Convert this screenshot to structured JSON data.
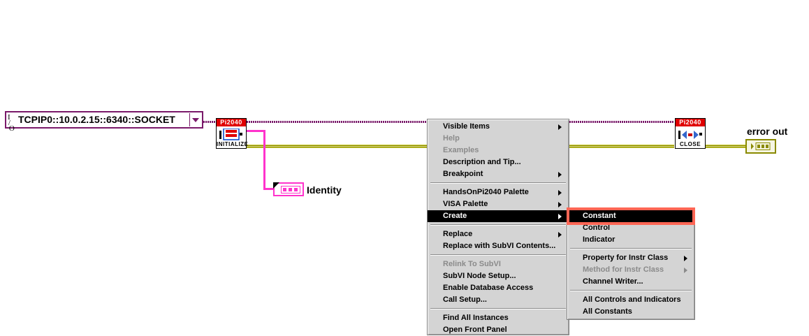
{
  "visa_control": {
    "io_label": "I/O",
    "value": "TCPIP0::10.0.2.15::6340::SOCKET"
  },
  "initialize_vi": {
    "header": "Pi2040",
    "footer": "INITIALIZE"
  },
  "close_vi": {
    "header": "Pi2040",
    "footer": "CLOSE"
  },
  "identity_indicator": {
    "label": "Identity"
  },
  "error_out_indicator": {
    "label": "error out"
  },
  "context_menu": {
    "items": [
      {
        "label": "Visible Items",
        "submenu": true,
        "disabled": false
      },
      {
        "label": "Help",
        "submenu": false,
        "disabled": true
      },
      {
        "label": "Examples",
        "submenu": false,
        "disabled": true
      },
      {
        "label": "Description and Tip...",
        "submenu": false,
        "disabled": false
      },
      {
        "label": "Breakpoint",
        "submenu": true,
        "disabled": false
      },
      {
        "label": "HandsOnPi2040 Palette",
        "submenu": true,
        "disabled": false
      },
      {
        "label": "VISA Palette",
        "submenu": true,
        "disabled": false
      },
      {
        "label": "Create",
        "submenu": true,
        "disabled": false,
        "selected": true
      },
      {
        "label": "Replace",
        "submenu": true,
        "disabled": false
      },
      {
        "label": "Replace with SubVI Contents...",
        "submenu": false,
        "disabled": false
      },
      {
        "label": "Relink To SubVI",
        "submenu": false,
        "disabled": true
      },
      {
        "label": "SubVI Node Setup...",
        "submenu": false,
        "disabled": false
      },
      {
        "label": "Enable Database Access",
        "submenu": false,
        "disabled": false
      },
      {
        "label": "Call Setup...",
        "submenu": false,
        "disabled": false
      },
      {
        "label": "Find All Instances",
        "submenu": false,
        "disabled": false
      },
      {
        "label": "Open Front Panel",
        "submenu": false,
        "disabled": false
      }
    ]
  },
  "create_submenu": {
    "items": [
      {
        "label": "Constant",
        "submenu": false,
        "disabled": false,
        "selected": true
      },
      {
        "label": "Control",
        "submenu": false,
        "disabled": false
      },
      {
        "label": "Indicator",
        "submenu": false,
        "disabled": false
      },
      {
        "label": "Property for Instr Class",
        "submenu": true,
        "disabled": false
      },
      {
        "label": "Method for Instr Class",
        "submenu": true,
        "disabled": true
      },
      {
        "label": "Channel Writer...",
        "submenu": false,
        "disabled": false
      },
      {
        "label": "All Controls and Indicators",
        "submenu": false,
        "disabled": false
      },
      {
        "label": "All Constants",
        "submenu": false,
        "disabled": false
      }
    ]
  },
  "colors": {
    "visa_wire": "#7a1a6a",
    "error_wire": "#8a8a00",
    "string_wire": "#ff33cc",
    "highlight": "#ff6655"
  }
}
